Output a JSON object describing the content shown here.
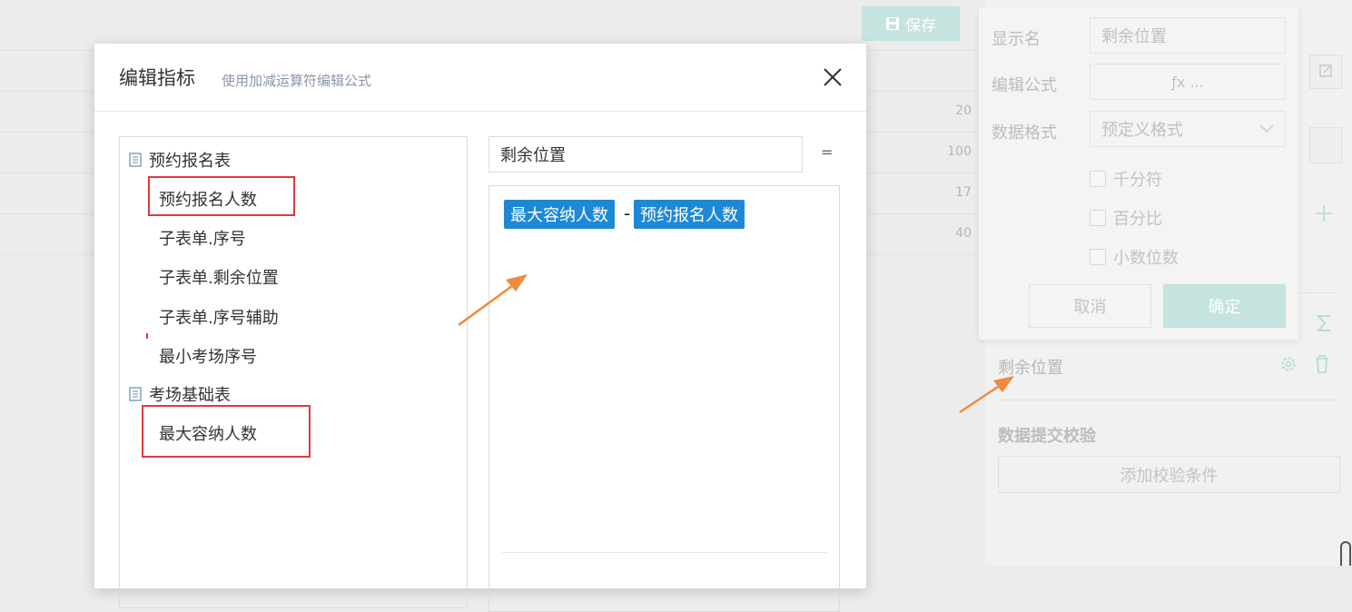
{
  "toolbar": {
    "save_label": "保存"
  },
  "background_rows": {
    "values": [
      "20",
      "100",
      "17",
      "40"
    ]
  },
  "popup": {
    "display_name_label": "显示名",
    "display_name_value": "剩余位置",
    "formula_label": "编辑公式",
    "formula_value": "ƒx ...",
    "format_label": "数据格式",
    "format_value": "预定义格式",
    "checks": [
      "千分符",
      "百分比",
      "小数位数"
    ],
    "cancel_label": "取消",
    "confirm_label": "确定"
  },
  "right_panel": {
    "field_name": "剩余位置",
    "section_title": "数据提交校验",
    "add_rule_label": "添加校验条件"
  },
  "modal": {
    "title": "编辑指标",
    "subtitle": "使用加减运算符编辑公式",
    "groups": [
      {
        "name": "预约报名表",
        "items": [
          "预约报名人数",
          "子表单.序号",
          "子表单.剩余位置",
          "子表单.序号辅助",
          "最小考场序号"
        ]
      },
      {
        "name": "考场基础表",
        "items": [
          "最大容纳人数"
        ]
      }
    ],
    "name_input_value": "剩余位置",
    "equals": "=",
    "formula": {
      "operand1": "最大容纳人数",
      "operator": "-",
      "operand2": "预约报名人数"
    }
  },
  "colors": {
    "chip": "#1e88d6",
    "highlight": "#e0393e",
    "arrow": "#f08a3c",
    "confirm": "#c5e3df"
  }
}
